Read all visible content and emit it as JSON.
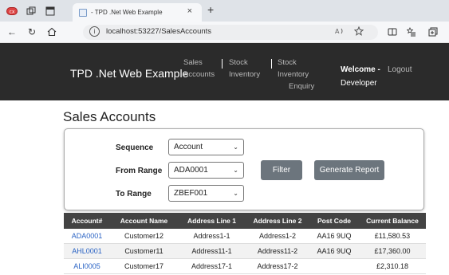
{
  "browser": {
    "tab_title": "- TPD .Net Web Example",
    "tab_close": "×",
    "new_tab": "+",
    "url": "localhost:53227/SalesAccounts",
    "info_glyph": "i"
  },
  "header": {
    "brand": "TPD .Net Web Example",
    "nav": [
      {
        "line1": "Sales",
        "line2": "Accounts"
      },
      {
        "line1": "Stock",
        "line2": "Inventory"
      },
      {
        "line1": "Stock",
        "line2": "Inventory",
        "line3": "Enquiry"
      }
    ],
    "welcome_bold": "Welcome -",
    "welcome_name": "Developer",
    "logout": "Logout"
  },
  "page": {
    "title": "Sales Accounts"
  },
  "filter": {
    "sequence_label": "Sequence",
    "sequence_value": "Account",
    "from_label": "From Range",
    "from_value": "ADA0001",
    "to_label": "To Range",
    "to_value": "ZBEF001",
    "filter_button": "Filter",
    "report_button": "Generate Report"
  },
  "table": {
    "columns": [
      "Account#",
      "Account Name",
      "Address Line 1",
      "Address Line 2",
      "Post Code",
      "Current Balance"
    ],
    "rows": [
      [
        "ADA0001",
        "Customer12",
        "Address1-1",
        "Address1-2",
        "AA16 9UQ",
        "£11,580.53"
      ],
      [
        "AHL0001",
        "Customer11",
        "Address11-1",
        "Address11-2",
        "AA16 9UQ",
        "£17,360.00"
      ],
      [
        "ALI0005",
        "Customer17",
        "Address17-1",
        "Address17-2",
        "",
        "£2,310.18"
      ]
    ]
  },
  "colors": {
    "header_bg": "#2b2b2b",
    "table_header_bg": "#434343",
    "button_bg": "#6c757d",
    "link": "#2a63c4"
  },
  "icons": {
    "close": "×",
    "chevron": "⌄",
    "back": "←",
    "refresh": "↻",
    "home": "⌂"
  }
}
